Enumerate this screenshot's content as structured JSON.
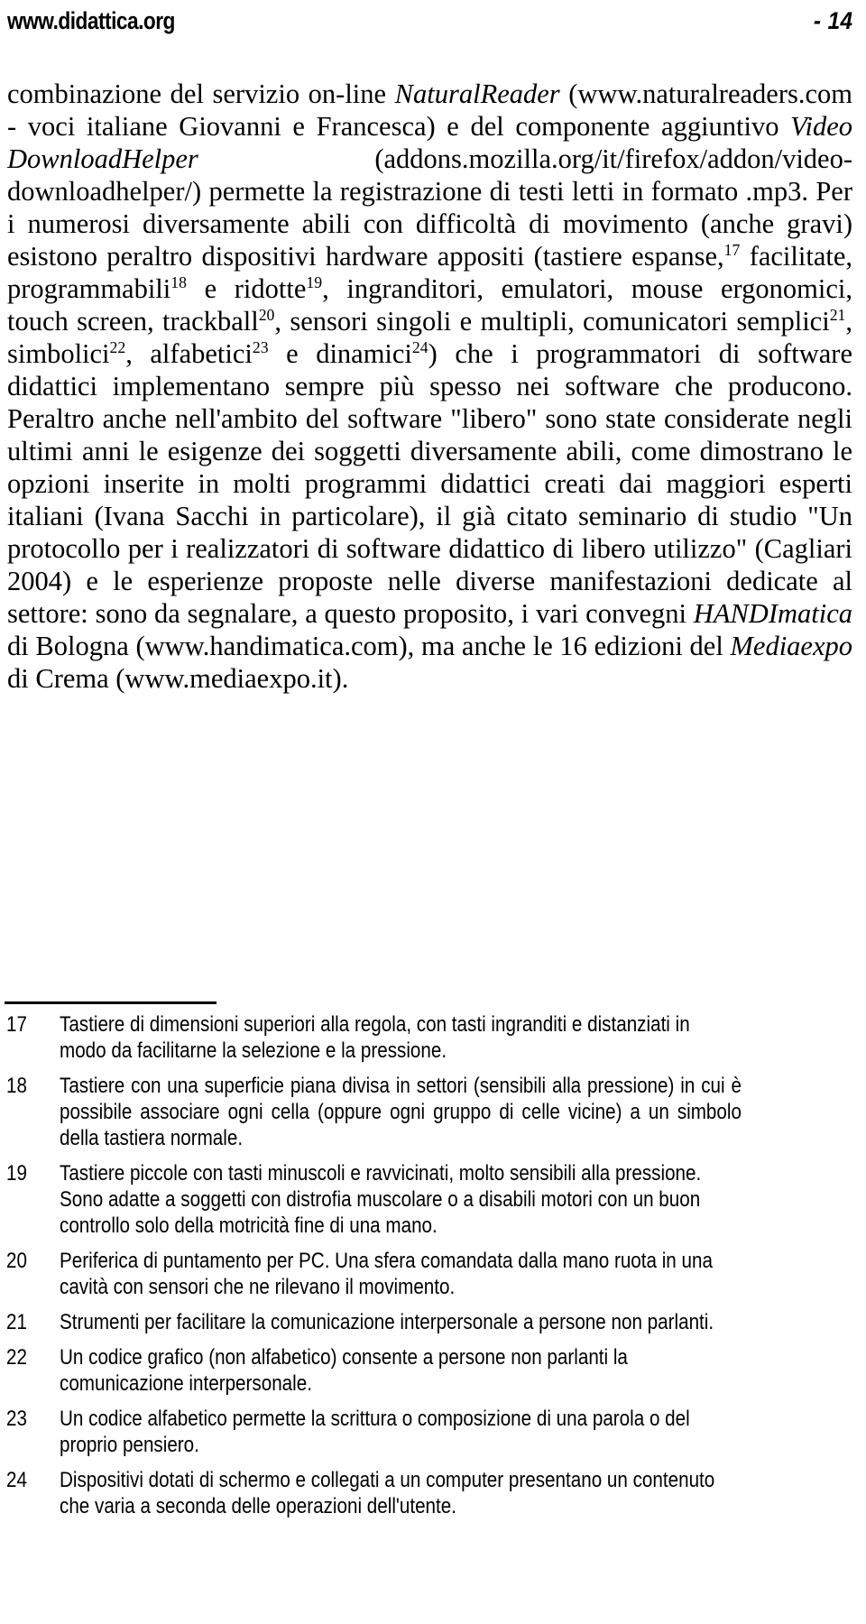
{
  "header": {
    "site": "www.didattica.org",
    "page_number": "- 14"
  },
  "body": {
    "segments": [
      {
        "text": "combinazione del servizio on-line ",
        "style": "normal"
      },
      {
        "text": "NaturalReader",
        "style": "italic"
      },
      {
        "text": " (www.naturalreaders.com - voci italiane Giovanni e Francesca) e del componente aggiuntivo ",
        "style": "normal"
      },
      {
        "text": "Video DownloadHelper",
        "style": "italic"
      },
      {
        "text": " (addons.mozilla.org/it/firefox/addon/video-downloadhelper/) permette la registrazione di testi letti in formato .mp3. Per i numerosi diversamente abili con difficoltà di movimento (anche gravi) esistono peraltro dispositivi hardware appositi (tastiere espanse,",
        "style": "normal"
      },
      {
        "text": "17",
        "style": "superscript"
      },
      {
        "text": " facilitate, programmabili",
        "style": "normal"
      },
      {
        "text": "18",
        "style": "superscript"
      },
      {
        "text": " e ridotte",
        "style": "normal"
      },
      {
        "text": "19",
        "style": "superscript"
      },
      {
        "text": ", ingranditori, emulatori, mouse ergonomici, touch screen, trackball",
        "style": "normal"
      },
      {
        "text": "20",
        "style": "superscript"
      },
      {
        "text": ", sensori singoli e multipli, comunicatori semplici",
        "style": "normal"
      },
      {
        "text": "21",
        "style": "superscript"
      },
      {
        "text": ", simbolici",
        "style": "normal"
      },
      {
        "text": "22",
        "style": "superscript"
      },
      {
        "text": ", alfabetici",
        "style": "normal"
      },
      {
        "text": "23",
        "style": "superscript"
      },
      {
        "text": " e dinamici",
        "style": "normal"
      },
      {
        "text": "24",
        "style": "superscript"
      },
      {
        "text": ") che i programmatori di software didattici implementano sempre più spesso nei software che producono. Peraltro anche nell'ambito del software \"libero\" sono state considerate negli ultimi anni le esigenze dei soggetti diversamente abili, come dimostrano le opzioni inserite in molti programmi didattici creati dai maggiori esperti italiani (Ivana Sacchi in particolare), il già citato seminario di studio \"Un protocollo per i realizzatori di software didattico di libero utilizzo\" (Cagliari 2004) e le esperienze proposte nelle diverse manifestazioni dedicate al settore: sono da segnalare, a questo proposito, i vari convegni ",
        "style": "normal"
      },
      {
        "text": "HANDImatica",
        "style": "italic"
      },
      {
        "text": " di Bologna (www.handimatica.com), ma anche le 16 edizioni del ",
        "style": "normal"
      },
      {
        "text": "Mediaexpo",
        "style": "italic"
      },
      {
        "text": " di Crema (www.mediaexpo.it).",
        "style": "normal"
      }
    ]
  },
  "footnotes": [
    {
      "number": "17",
      "text": "Tastiere di dimensioni superiori alla regola, con tasti ingranditi e distanziati in modo da facilitarne la selezione e la pressione.",
      "justified": false
    },
    {
      "number": "18",
      "text": "Tastiere con una superficie piana divisa in settori (sensibili alla pressione) in cui è possibile associare ogni cella (oppure ogni gruppo di celle vicine) a un simbolo della tastiera normale.",
      "justified": true
    },
    {
      "number": "19",
      "text": "Tastiere piccole con tasti minuscoli e ravvicinati, molto sensibili alla pressione. Sono adatte a soggetti con distrofia muscolare o a disabili motori con un buon controllo solo della motricità fine di una mano.",
      "justified": false
    },
    {
      "number": "20",
      "text": "Periferica di puntamento per PC. Una sfera comandata dalla mano ruota in una cavità con sensori che ne rilevano il movimento.",
      "justified": false
    },
    {
      "number": "21",
      "text": "Strumenti per facilitare la comunicazione interpersonale a persone non parlanti.",
      "justified": false
    },
    {
      "number": "22",
      "text": "Un codice grafico (non alfabetico) consente a persone non parlanti la comunicazione interpersonale.",
      "justified": false
    },
    {
      "number": "23",
      "text": "Un codice alfabetico permette la scrittura o composizione di una parola o del proprio pensiero.",
      "justified": false
    },
    {
      "number": "24",
      "text": "Dispositivi dotati di schermo e collegati a un computer presentano un contenuto che varia a seconda delle operazioni dell'utente.",
      "justified": false
    }
  ]
}
